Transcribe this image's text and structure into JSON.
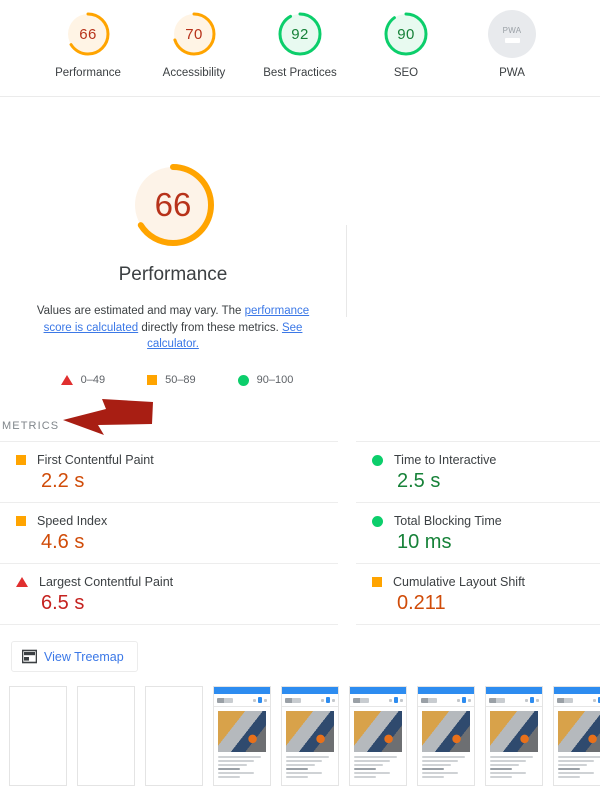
{
  "top_gauges": [
    {
      "score": "66",
      "label": "Performance",
      "color": "#ffa400",
      "track": "#fff4e5",
      "text_color": "#b7321a",
      "pct": 66
    },
    {
      "score": "70",
      "label": "Accessibility",
      "color": "#ffa400",
      "track": "#fff4e5",
      "text_color": "#b7321a",
      "pct": 70
    },
    {
      "score": "92",
      "label": "Best Practices",
      "color": "#0cce6b",
      "track": "#e8faf0",
      "text_color": "#178239",
      "pct": 92
    },
    {
      "score": "90",
      "label": "SEO",
      "color": "#0cce6b",
      "track": "#e8faf0",
      "text_color": "#178239",
      "pct": 90
    },
    {
      "score": "",
      "label": "PWA",
      "badge_text": "PWA",
      "color": "#e8eaed",
      "track": "#e8eaed",
      "text_color": "#9aa0a6",
      "pct": 0
    }
  ],
  "hero": {
    "score": "66",
    "title": "Performance",
    "pct": 66,
    "color": "#ffa400",
    "track": "#fff4e5",
    "text_color": "#b7321a",
    "desc_part1": "Values are estimated and may vary. The ",
    "desc_link1": "performance score is calculated",
    "desc_part2": " directly from these metrics. ",
    "desc_link2": "See calculator."
  },
  "legend": [
    {
      "icon": "triangle-icon",
      "label": "0–49",
      "color": "#e02f2f"
    },
    {
      "icon": "square-icon",
      "label": "50–89",
      "color": "#ffa400"
    },
    {
      "icon": "circle-icon",
      "label": "90–100",
      "color": "#0cce6b"
    }
  ],
  "metrics_section": {
    "heading": "METRICS",
    "annotation_arrow_color": "#a81e13"
  },
  "metrics_left": [
    {
      "name": "First Contentful Paint",
      "value": "2.2 s",
      "icon": "square-icon",
      "rating": "average"
    },
    {
      "name": "Speed Index",
      "value": "4.6 s",
      "icon": "square-icon",
      "rating": "average"
    },
    {
      "name": "Largest Contentful Paint",
      "value": "6.5 s",
      "icon": "triangle-icon",
      "rating": "poor"
    }
  ],
  "metrics_right": [
    {
      "name": "Time to Interactive",
      "value": "2.5 s",
      "icon": "circle-icon",
      "rating": "good"
    },
    {
      "name": "Total Blocking Time",
      "value": "10 ms",
      "icon": "circle-icon",
      "rating": "good"
    },
    {
      "name": "Cumulative Layout Shift",
      "value": "0.211",
      "icon": "square-icon",
      "rating": "average"
    }
  ],
  "treemap": {
    "label": "View Treemap",
    "icon": "treemap-icon"
  },
  "filmstrip": {
    "frames": [
      {
        "state": "blank"
      },
      {
        "state": "blank"
      },
      {
        "state": "blank"
      },
      {
        "state": "loaded"
      },
      {
        "state": "loaded"
      },
      {
        "state": "loaded"
      },
      {
        "state": "loaded"
      },
      {
        "state": "loaded"
      },
      {
        "state": "loaded"
      }
    ]
  }
}
